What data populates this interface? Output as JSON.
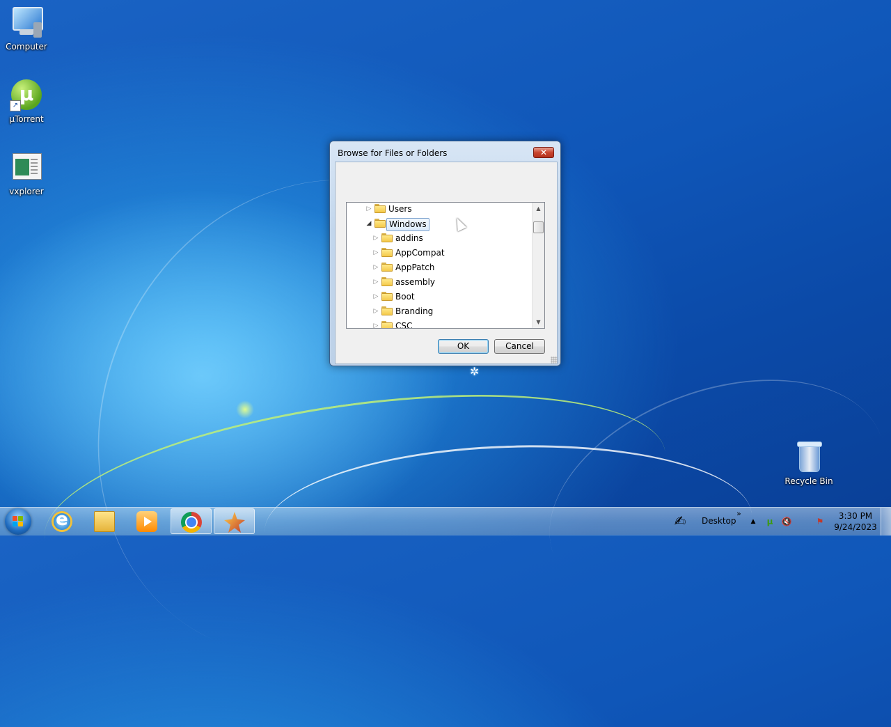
{
  "desktop": {
    "icons": [
      {
        "label": "Computer"
      },
      {
        "label": "µTorrent"
      },
      {
        "label": "vxplorer"
      },
      {
        "label": "Recycle Bin"
      }
    ]
  },
  "dialog": {
    "title": "Browse for Files or Folders",
    "close_glyph": "✕",
    "tree": [
      {
        "label": "Users",
        "expander": "▷"
      },
      {
        "label": "Windows",
        "expander": "◢",
        "selected": true
      },
      {
        "label": "addins",
        "expander": "▷"
      },
      {
        "label": "AppCompat",
        "expander": "▷"
      },
      {
        "label": "AppPatch",
        "expander": "▷"
      },
      {
        "label": "assembly",
        "expander": "▷"
      },
      {
        "label": "Boot",
        "expander": "▷"
      },
      {
        "label": "Branding",
        "expander": "▷"
      },
      {
        "label": "CSC",
        "expander": "▷"
      }
    ],
    "ok_label": "OK",
    "cancel_label": "Cancel"
  },
  "taskbar": {
    "desktop_toolbar_label": "Desktop",
    "chevron": "»",
    "tray_expand": "▲",
    "time": "3:30 PM",
    "date": "9/24/2023"
  }
}
